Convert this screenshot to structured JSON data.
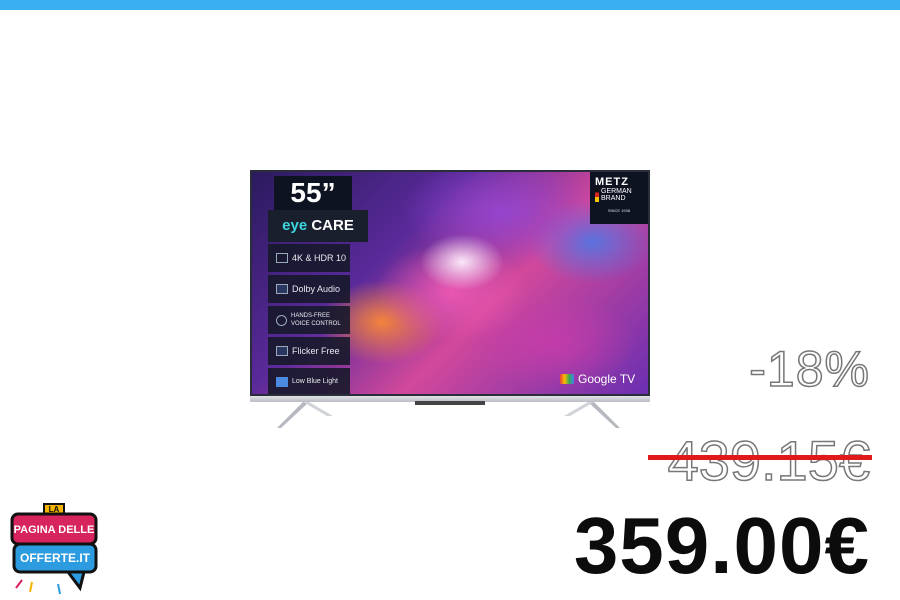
{
  "brand_bar_color": "#3ab0f0",
  "product": {
    "screen_size": "55”",
    "eye_care": {
      "part1": "eye",
      "part2": " CARE"
    },
    "features": [
      {
        "label": "4K & HDR 10",
        "icon": "resolution-icon"
      },
      {
        "label": "Dolby Audio",
        "icon": "dolby-icon"
      },
      {
        "label": "HANDS-FREE VOICE CONTROL",
        "icon": "microphone-icon"
      },
      {
        "label": "Flicker Free",
        "icon": "flicker-free-icon"
      },
      {
        "label": "Low Blue Light",
        "icon": "low-blue-light-icon"
      }
    ],
    "brand": {
      "name": "METZ",
      "tagline_1": "GERMAN",
      "tagline_2": "BRAND",
      "since": "SINCE 1938"
    },
    "platform": "Google TV"
  },
  "pricing": {
    "discount": "-18%",
    "old_price": "439.15€",
    "new_price": "359.00€",
    "strike_color": "#e01a1a"
  },
  "logo": {
    "top": "LA",
    "line1": "PAGINA DELLE",
    "line2": "OFFERTE.IT"
  }
}
